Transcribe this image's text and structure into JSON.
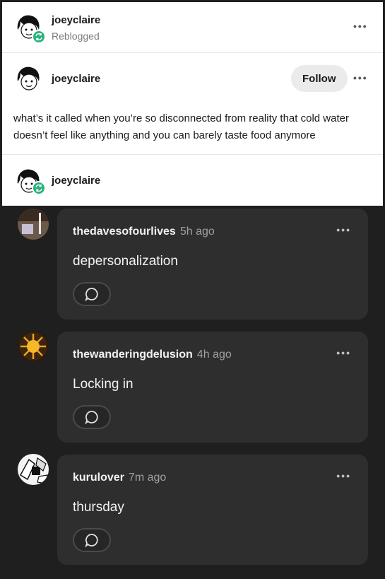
{
  "reblog_header": {
    "username": "joeyclaire",
    "status": "Reblogged",
    "more_label": "•••"
  },
  "post": {
    "username": "joeyclaire",
    "follow_label": "Follow",
    "more_label": "•••",
    "text": "what’s it called when you’re so disconnected from reality that cold water doesn’t feel like anything and you can barely taste food anymore"
  },
  "reblogger": {
    "username": "joeyclaire"
  },
  "comments": [
    {
      "username": "thedavesofourlives",
      "time": "5h ago",
      "text": "depersonalization",
      "more_label": "•••"
    },
    {
      "username": "thewanderingdelusion",
      "time": "4h ago",
      "text": "Locking in",
      "more_label": "•••"
    },
    {
      "username": "kurulover",
      "time": "7m ago",
      "text": "thursday",
      "more_label": "•••"
    }
  ],
  "colors": {
    "reblog_green": "#2ab27b",
    "dark_bg": "#1f1f1f",
    "comment_bg": "#2e2e2e"
  }
}
